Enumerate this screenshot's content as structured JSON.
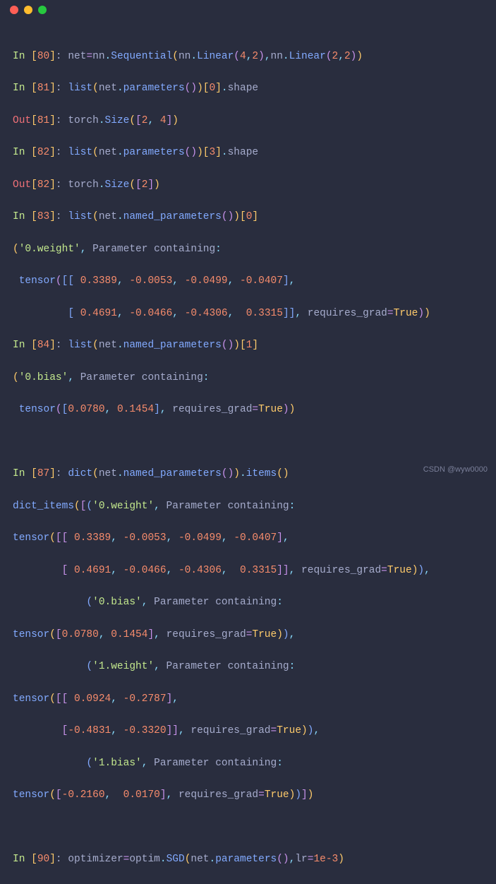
{
  "titlebar": {
    "dots": [
      "red",
      "yellow",
      "green"
    ]
  },
  "watermark": "CSDN @wyw0000",
  "lines": {
    "l1": {
      "in": "80",
      "pre": "In ",
      "code": "net=nn.Sequential(nn.Linear(4,2),nn.Linear(2,2))"
    },
    "l2": {
      "in": "81",
      "pre": "In ",
      "code": "list(net.parameters())[0].shape"
    },
    "l3": {
      "out": "81",
      "pre": "Out",
      "text": "torch.Size([2, 4])"
    },
    "l4": {
      "in": "82",
      "pre": "In ",
      "code": "list(net.parameters())[3].shape"
    },
    "l5": {
      "out": "82",
      "pre": "Out",
      "text": "torch.Size([2])"
    },
    "l6": {
      "in": "83",
      "pre": "In ",
      "code": "list(net.named_parameters())[0]"
    },
    "l7": "('0.weight', Parameter containing:",
    "l8": " tensor([[ 0.3389, -0.0053, -0.0499, -0.0407],",
    "l9": "         [ 0.4691, -0.0466, -0.4306,  0.3315]], requires_grad=True))",
    "l10": {
      "in": "84",
      "pre": "In ",
      "code": "list(net.named_parameters())[1]"
    },
    "l11": "('0.bias', Parameter containing:",
    "l12": " tensor([0.0780, 0.1454], requires_grad=True))",
    "blank1": "",
    "l13": {
      "in": "87",
      "pre": "In ",
      "code": "dict(net.named_parameters()).items()"
    },
    "l14": "dict_items([('0.weight', Parameter containing:",
    "l15": "tensor([[ 0.3389, -0.0053, -0.0499, -0.0407],",
    "l16": "        [ 0.4691, -0.0466, -0.4306,  0.3315]], requires_grad=True)),",
    "l17": "            ('0.bias', Parameter containing:",
    "l18": "tensor([0.0780, 0.1454], requires_grad=True)),",
    "l19": "            ('1.weight', Parameter containing:",
    "l20": "tensor([[ 0.0924, -0.2787],",
    "l21": "        [-0.4831, -0.3320]], requires_grad=True)),",
    "l22": "            ('1.bias', Parameter containing:",
    "l23": "tensor([-0.2160,  0.0170], requires_grad=True))])",
    "blank2": "",
    "l24": {
      "in": "90",
      "pre": "In ",
      "code": "optimizer=optim.SGD(net.parameters(),lr=1e-3)"
    }
  },
  "tokens": {
    "In": "In ",
    "Out": "Out",
    "lb": "[",
    "rb": "]",
    "colon": ": ",
    "n80": "80",
    "n81": "81",
    "n82": "82",
    "n83": "83",
    "n84": "84",
    "n87": "87",
    "n90": "90",
    "net": "net",
    "eq": "=",
    "nn": "nn",
    "dot": ".",
    "Sequential": "Sequential",
    "lp": "(",
    "rp": ")",
    "Linear": "Linear",
    "c": ",",
    "n4": "4",
    "n2": "2",
    "n3": "3",
    "n0": "0",
    "n1": "1",
    "list": "list",
    "parameters": "parameters",
    "shape": "shape",
    "torch": "torch",
    "Size": "Size",
    "sp": " ",
    "named_parameters": "named_parameters",
    "dict": "dict",
    "items": "items",
    "optimizer": "optimizer",
    "optim": "optim",
    "SGD": "SGD",
    "lr": "lr",
    "v1e3": "1e-3",
    "qw0": "'0.weight'",
    "qb0": "'0.bias'",
    "qw1": "'1.weight'",
    "qb1": "'1.bias'",
    "Parameter": "Parameter",
    "containing": "containing",
    "tensor": "tensor",
    "requires_grad": "requires_grad",
    "True": "True",
    "dict_items": "dict_items",
    "v0_3389": "0.3389",
    "vn0_0053": "-0.0053",
    "vn0_0499": "-0.0499",
    "vn0_0407": "-0.0407",
    "v0_4691": "0.4691",
    "vn0_0466": "-0.0466",
    "vn0_4306": "-0.4306",
    "v0_3315": "0.3315",
    "v0_0780": "0.0780",
    "v0_1454": "0.1454",
    "v0_0924": "0.0924",
    "vn0_2787": "-0.2787",
    "vn0_4831": "-0.4831",
    "vn0_3320": "-0.3320",
    "vn0_2160": "-0.2160",
    "v0_0170": "0.0170"
  }
}
